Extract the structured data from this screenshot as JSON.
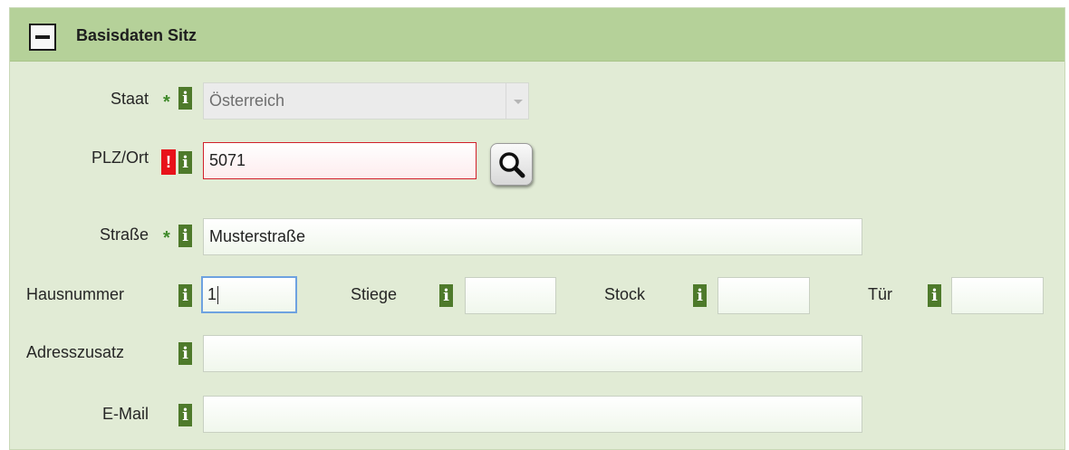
{
  "section": {
    "title": "Basisdaten Sitz",
    "collapse_icon": "minus-square-icon"
  },
  "info_icon_glyph": "i",
  "required_mark": "*",
  "error_mark": "!",
  "fields": {
    "staat": {
      "label": "Staat",
      "value": "Österreich"
    },
    "plz_ort": {
      "label": "PLZ/Ort",
      "value": "5071"
    },
    "strasse": {
      "label": "Straße",
      "value": "Musterstraße"
    },
    "hausnummer": {
      "label": "Hausnummer",
      "value": "1"
    },
    "stiege": {
      "label": "Stiege",
      "value": ""
    },
    "stock": {
      "label": "Stock",
      "value": ""
    },
    "tuer": {
      "label": "Tür",
      "value": ""
    },
    "adresszusatz": {
      "label": "Adresszusatz",
      "value": ""
    },
    "email": {
      "label": "E-Mail",
      "value": ""
    }
  },
  "search_button_icon": "magnifier-icon",
  "colors": {
    "header": "#b5d199",
    "panel": "#e1ebd5",
    "info": "#4e7a2b",
    "error": "#e8121a",
    "required": "#3f8a2a"
  }
}
